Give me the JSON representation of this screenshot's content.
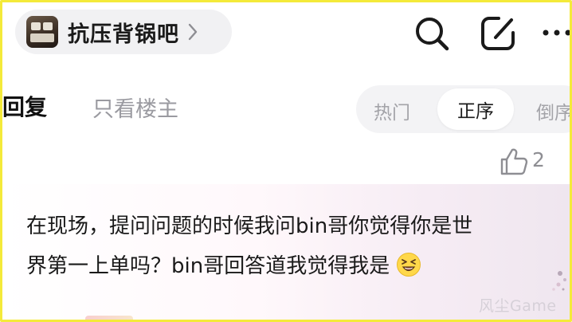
{
  "header": {
    "forum_name": "抗压背锅吧",
    "icons": [
      "forum-avatar",
      "chevron-right-icon",
      "search-icon",
      "edit-icon",
      "more-icon"
    ]
  },
  "tabs": {
    "reply": "回复",
    "owner_only": "只看楼主"
  },
  "sort": {
    "hot": "热门",
    "positive": "正序",
    "reverse": "倒序",
    "selected": "正序"
  },
  "post": {
    "like_count": "2",
    "comment_line1": "在现场，提问问题的时候我问bin哥你觉得你是世",
    "comment_line2": "界第一上单吗？bin哥回答道我觉得我是",
    "emoji": "grinning-squint-emoji"
  },
  "watermark": "风尘Game",
  "colors": {
    "frame_border": "#f4ea3a",
    "pill_bg": "#f1f1f3",
    "muted_text": "#9a9aa0"
  }
}
